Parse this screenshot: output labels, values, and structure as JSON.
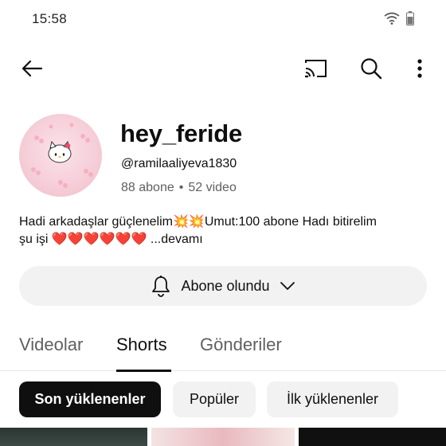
{
  "status_bar": {
    "time": "15:58"
  },
  "top_bar": {
    "icons": [
      "back-arrow-icon",
      "cast-icon",
      "search-icon",
      "more-vertical-icon"
    ]
  },
  "channel": {
    "name": "hey_feride",
    "handle": "@ramilaaliyeva1830",
    "subscribers": "88 abone",
    "separator": "•",
    "videos": "52 video",
    "description_line1": "Hadi arkadaşlar güçlenelim💥💥Umut:100 abone Hadı bitirelim",
    "description_line2": "şu işi ❤️❤️❤️❤️❤️❤️",
    "description_more": "...devamı"
  },
  "subscribe_button": {
    "label": "Abone olundu"
  },
  "tabs": [
    {
      "label": "Videolar"
    },
    {
      "label": "Shorts",
      "selected": true
    },
    {
      "label": "Gönderiler"
    }
  ],
  "filter_chips": [
    {
      "label": "Son yüklenenler",
      "selected": true
    },
    {
      "label": "Popüler"
    },
    {
      "label": "İlk yüklenenler"
    }
  ],
  "colors": {
    "text": "#0f0f0f",
    "secondary": "#606060",
    "chip_bg": "#f2f2f2",
    "selected_chip": "#0f0f0f"
  }
}
